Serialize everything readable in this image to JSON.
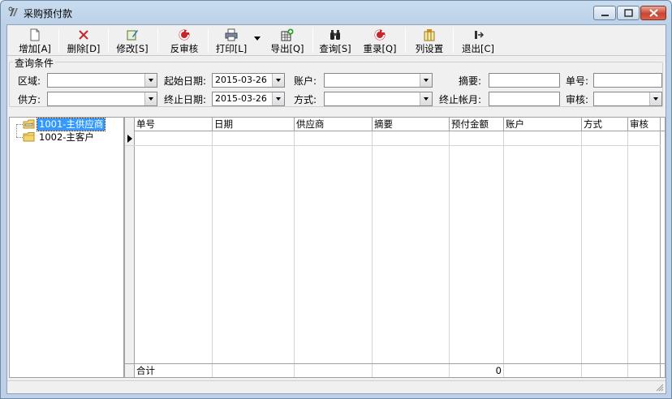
{
  "window": {
    "title": "采购预付款"
  },
  "toolbar": {
    "buttons": [
      {
        "label": "增加[A]",
        "icon": "new-document-icon"
      },
      {
        "label": "删除[D]",
        "icon": "delete-x-icon"
      },
      {
        "label": "修改[S]",
        "icon": "edit-icon"
      },
      {
        "label": "反审核",
        "icon": "unaudit-icon"
      },
      {
        "label": "打印[L]",
        "icon": "printer-icon"
      },
      {
        "label": "导出[Q]",
        "icon": "export-icon"
      },
      {
        "label": "查询[S]",
        "icon": "binoculars-icon"
      },
      {
        "label": "重录[Q]",
        "icon": "reset-icon"
      },
      {
        "label": "列设置",
        "icon": "column-settings-icon"
      },
      {
        "label": "退出[C]",
        "icon": "exit-icon"
      }
    ]
  },
  "query": {
    "legend": "查询条件",
    "region_label": "区域:",
    "region_value": "",
    "start_date_label": "起始日期:",
    "start_date_value": "2015-03-26",
    "account_label": "账户:",
    "account_value": "",
    "summary_label": "摘要:",
    "summary_value": "",
    "number_label": "单号:",
    "number_value": "",
    "supplier_label": "供方:",
    "supplier_value": "",
    "end_date_label": "终止日期:",
    "end_date_value": "2015-03-26",
    "method_label": "方式:",
    "method_value": "",
    "end_period_label": "终止帐月:",
    "end_period_value": "",
    "audit_label": "审核:",
    "audit_value": ""
  },
  "tree": {
    "items": [
      {
        "label": "1001-主供应商",
        "selected": true
      },
      {
        "label": "1002-主客户",
        "selected": false
      }
    ]
  },
  "grid": {
    "columns": [
      "单号",
      "日期",
      "供应商",
      "摘要",
      "预付金额",
      "账户",
      "方式",
      "审核"
    ],
    "footer": {
      "label": "合计",
      "amount": "0"
    }
  }
}
